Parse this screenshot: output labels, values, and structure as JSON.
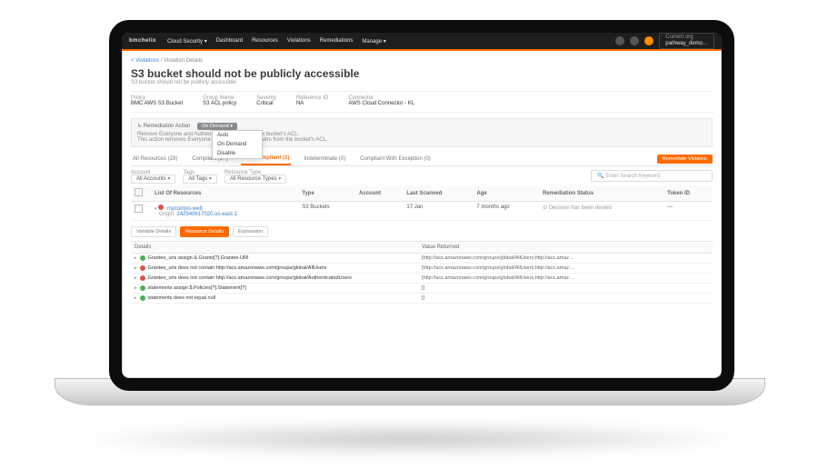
{
  "nav": {
    "brand": "bmchelix",
    "items": [
      "Cloud Security ▾",
      "Dashboard",
      "Resources",
      "Violations",
      "Remediations",
      "Manage ▾"
    ],
    "user_label": "Current org",
    "user_value": "pathway_demo…"
  },
  "crumbs": {
    "a": "< Violations",
    "sep": "/",
    "b": "Violation Details"
  },
  "page": {
    "title": "S3 bucket should not be publicly accessible",
    "subtitle": "S3 bucket should not be publicly accessible"
  },
  "meta": {
    "policy_l": "Policy",
    "policy_v": "BMC AWS S3 Bucket",
    "group_l": "Group Name",
    "group_v": "S3 ACL policy",
    "sev_l": "Severity",
    "sev_v": "Critical",
    "ref_l": "Reference ID",
    "ref_v": "NA",
    "conn_l": "Connector",
    "conn_v": "AWS Cloud Connector - KL"
  },
  "remed": {
    "lbl": "↳ Remediation Action",
    "badge": "On Demand ▾",
    "line1": "Remove Everyone and Authenticated Users from the bucket's ACL.",
    "line2": "This action removes Everyone and Authenticated Users from the bucket's ACL.",
    "dropdown": [
      "Auto",
      "On Demand",
      "Disable"
    ]
  },
  "tabs": {
    "all": "All Resources (28)",
    "compliant": "Compliant (27)",
    "non": "Non Compliant (1)",
    "indet": "Indeterminate (0)",
    "exc": "Compliant With Exception (0)",
    "btn": "Remediate Violation"
  },
  "filters": {
    "acc_l": "Account",
    "acc_v": "All Accounts",
    "tag_l": "Tags",
    "tag_v": "All Tags",
    "rtype_l": "Resource Type",
    "rtype_v": "All Resource Types",
    "search": "🔍 Enter Search Keyword"
  },
  "table": {
    "h1": "List Of Resources",
    "h2": "Type",
    "h3": "Account",
    "h4": "Last Scanned",
    "h5": "Age",
    "h6": "Remediation Status",
    "h7": "Token ID",
    "r_name": "mycompo-web",
    "r_origin_l": "Origin:",
    "r_origin_v": "242940617020.us-east-1",
    "r_type": "S3 Buckets",
    "r_lastscan": "17 Jan",
    "r_age": "7 months ago",
    "r_rstat": "⊘ Decision has been denied",
    "r_token": "—"
  },
  "subtabs": {
    "a": "Variable Details",
    "b": "Resource Details",
    "c": "Expression"
  },
  "details": {
    "h1": "Details",
    "h2": "Value Returned",
    "rows": [
      {
        "s": "sg",
        "t": "Grantee_uris assign & Grants[?].Grantee.URI",
        "v": "[http://acs.amazonaws.com/groups/global/AllUsers,http://acs.amaz…"
      },
      {
        "s": "sr",
        "t": "Grantee_uris does not contain http://acs.amazonaws.com/groups/global/AllUsers",
        "v": "[http://acs.amazonaws.com/groups/global/AllUsers,http://acs.amaz…"
      },
      {
        "s": "sr",
        "t": "Grantee_uris does not contain http://acs.amazonaws.com/groups/global/AuthenticatedUsers",
        "v": "[http://acs.amazonaws.com/groups/global/AllUsers,http://acs.amaz…"
      },
      {
        "s": "sg",
        "t": "statements assign $.Policies[?].Statement[?]",
        "v": "[]"
      },
      {
        "s": "sg",
        "t": "statements does not equal null",
        "v": "[]"
      }
    ]
  }
}
